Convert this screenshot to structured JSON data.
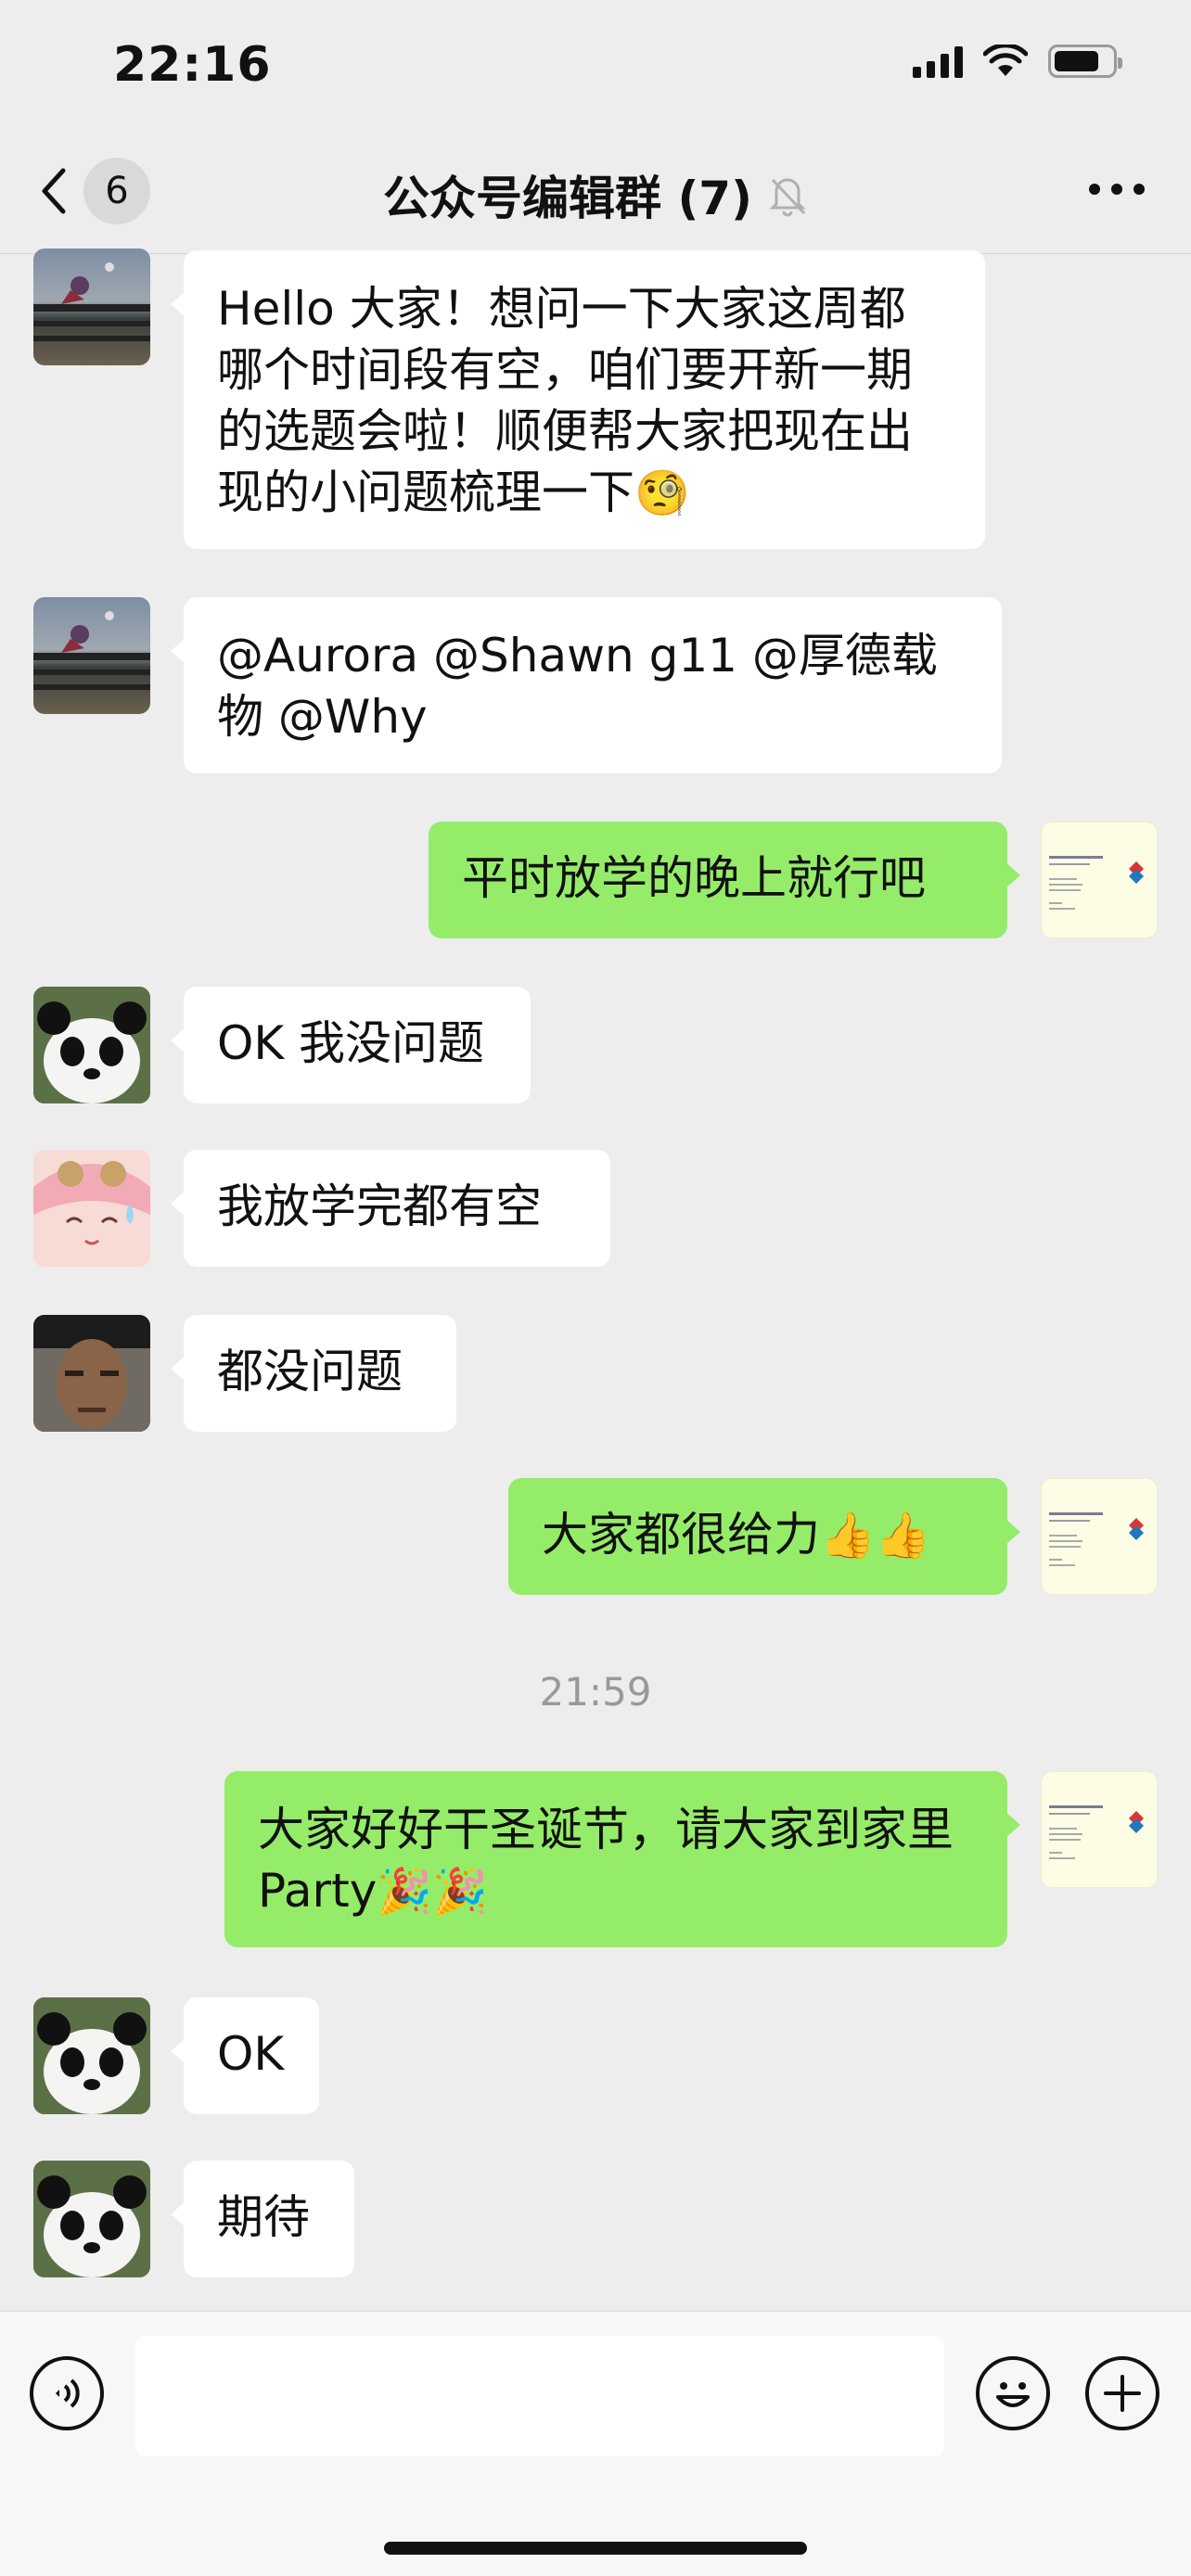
{
  "status_bar": {
    "time": "22:16"
  },
  "nav": {
    "unread_count": "6",
    "title": "公众号编辑群 (7)",
    "muted_icon": "bell-slash-icon",
    "more_icon": "ellipsis-icon"
  },
  "messages": [
    {
      "side": "in",
      "avatar": "anime-character",
      "text": "Hello 大家！想问一下大家这周都哪个时间段有空，咱们要开新一期的选题会啦！顺便帮大家把现在出现的小问题梳理一下",
      "emoji": "🧐"
    },
    {
      "side": "in",
      "avatar": "anime-character",
      "text": "@Aurora @Shawn g11 @厚德载物 @Why"
    },
    {
      "side": "out",
      "avatar": "business-card",
      "text": "平时放学的晚上就行吧"
    },
    {
      "side": "in",
      "avatar": "panda",
      "text": "OK 我没问题"
    },
    {
      "side": "in",
      "avatar": "anime-girl",
      "text": "我放学完都有空"
    },
    {
      "side": "in",
      "avatar": "man-portrait",
      "text": "都没问题"
    },
    {
      "side": "out",
      "avatar": "business-card",
      "text": "大家都很给力",
      "emoji": "👍👍"
    },
    {
      "side": "out",
      "avatar": "business-card",
      "text": "大家好好干圣诞节，请大家到家里 Party",
      "emoji": "🎉🎉"
    },
    {
      "side": "in",
      "avatar": "panda",
      "text": "OK"
    },
    {
      "side": "in",
      "avatar": "panda",
      "text": "期待"
    }
  ],
  "time_separator": "21:59",
  "input_bar": {
    "voice_icon": "voice-icon",
    "text_value": "",
    "emoji_icon": "smiley-icon",
    "plus_icon": "plus-icon"
  }
}
